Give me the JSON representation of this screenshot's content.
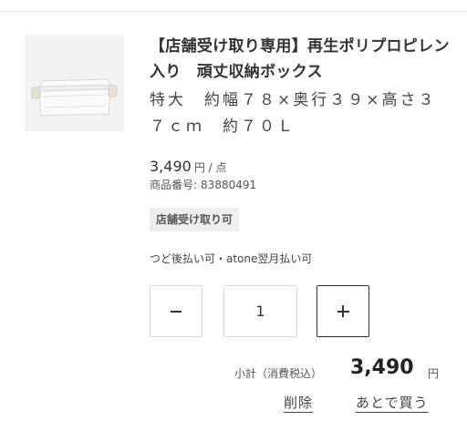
{
  "cart_item": {
    "thumbnail_alt": "storage-box-image",
    "title": "【店舗受け取り専用】再生ポリプロピレン入り　頑丈収納ボックス",
    "subtitle": "特大　約幅７８×奥行３９×高さ３７ｃｍ　約７０Ｌ",
    "price": "3,490",
    "price_unit": "円 / 点",
    "item_number_label": "商品番号:",
    "item_number": "83880491",
    "store_pickup_badge": "店舗受け取り可",
    "payment_note": "つど後払い可・atone翌月払い可"
  },
  "quantity": {
    "value": "1",
    "minus_icon": "minus-icon",
    "plus_icon": "plus-icon"
  },
  "subtotal": {
    "label": "小計（消費税込）",
    "value": "3,490",
    "unit": "円"
  },
  "actions": {
    "delete_label": "削除",
    "buy_later_label": "あとで買う"
  },
  "colors": {
    "text": "#333333",
    "border": "#d9d9d9",
    "badge_bg": "#eeeeee",
    "thumb_bg": "#f2f2f2"
  }
}
